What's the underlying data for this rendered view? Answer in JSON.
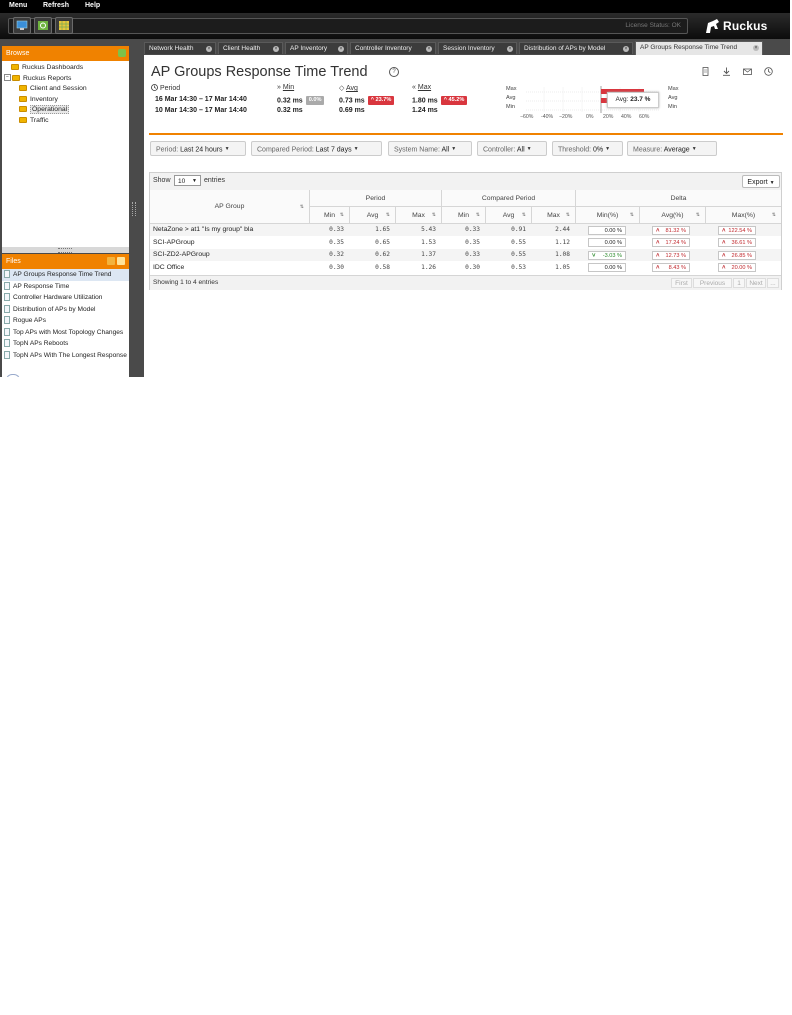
{
  "menu": [
    "Menu",
    "Refresh",
    "Help"
  ],
  "toolbar": {
    "license_status": "License Status: OK",
    "brand": "Ruckus"
  },
  "browse": {
    "title": "Browse",
    "tree": [
      {
        "label": "Ruckus Dashboards",
        "level": 0
      },
      {
        "label": "Ruckus Reports",
        "level": 0,
        "expanded": true
      },
      {
        "label": "Client and Session",
        "level": 1
      },
      {
        "label": "Inventory",
        "level": 1
      },
      {
        "label": "Operational",
        "level": 1,
        "selected": true
      },
      {
        "label": "Traffic",
        "level": 1
      }
    ]
  },
  "files": {
    "title": "Files",
    "items": [
      "AP Groups Response Time Trend",
      "AP Response Time",
      "Controller Hardware Utilization",
      "Distribution of APs by Model",
      "Rogue APs",
      "Top APs with Most Topology Changes",
      "TopN APs Reboots",
      "TopN APs With The Longest Response"
    ]
  },
  "tabs": [
    {
      "label": "Network Health",
      "active": false
    },
    {
      "label": "Client Health",
      "active": false
    },
    {
      "label": "AP Inventory",
      "active": false
    },
    {
      "label": "Controller Inventory",
      "active": false
    },
    {
      "label": "Session Inventory",
      "active": false
    },
    {
      "label": "Distribution of APs by Model",
      "active": false
    },
    {
      "label": "AP Groups Response Time Trend",
      "active": true
    }
  ],
  "report": {
    "title": "AP Groups Response Time Trend",
    "period_label": "Period",
    "min_label": "Min",
    "avg_label": "Avg",
    "max_label": "Max",
    "period": "16 Mar 14:30 – 17 Mar 14:40",
    "compared_period": "10 Mar 14:30 – 17 Mar 14:40",
    "period_min": "0.32 ms",
    "period_min_delta": "0.0%",
    "period_avg": "0.73 ms",
    "period_avg_delta": "23.7%",
    "period_max": "1.80 ms",
    "period_max_delta": "45.2%",
    "compared_min": "0.32 ms",
    "compared_avg": "0.69 ms",
    "compared_max": "1.24 ms"
  },
  "mini_chart": {
    "left_labels": [
      "Max",
      "Avg",
      "Min"
    ],
    "right_labels": [
      "Max",
      "Avg",
      "Min"
    ],
    "ticks": [
      "−60%",
      "-40%",
      "−20%",
      "0%",
      "20%",
      "40%",
      "60%"
    ],
    "tooltip_label": "Avg:",
    "tooltip_value": "23.7 %",
    "bar_color": "#d9363e"
  },
  "filters": {
    "period": {
      "label": "Period:",
      "value": "Last 24 hours"
    },
    "compared": {
      "label": "Compared Period:",
      "value": "Last 7 days"
    },
    "system": {
      "label": "System Name:",
      "value": "All"
    },
    "controller": {
      "label": "Controller:",
      "value": "All"
    },
    "threshold": {
      "label": "Threshold:",
      "value": "0%"
    },
    "measure": {
      "label": "Measure:",
      "value": "Average"
    }
  },
  "table": {
    "show_label": "Show",
    "entries_label": "entries",
    "page_size": "10",
    "export_label": "Export",
    "group_headers": {
      "ap_group": "AP Group",
      "period": "Period",
      "compared": "Compared Period",
      "delta": "Delta"
    },
    "sub_headers": [
      "Min",
      "Avg",
      "Max",
      "Min",
      "Avg",
      "Max",
      "Min(%)",
      "Avg(%)",
      "Max(%)"
    ],
    "rows": [
      {
        "name": "NetaZone > at1 \"Is my group\" bla",
        "p_min": "0.33",
        "p_avg": "1.65",
        "p_max": "5.43",
        "c_min": "0.33",
        "c_avg": "0.91",
        "c_max": "2.44",
        "d_min": "0.00 %",
        "d_min_dir": "none",
        "d_avg": "81.32 %",
        "d_avg_dir": "up",
        "d_max": "122.54 %",
        "d_max_dir": "up"
      },
      {
        "name": "SCI-APGroup",
        "p_min": "0.35",
        "p_avg": "0.65",
        "p_max": "1.53",
        "c_min": "0.35",
        "c_avg": "0.55",
        "c_max": "1.12",
        "d_min": "0.00 %",
        "d_min_dir": "none",
        "d_avg": "17.24 %",
        "d_avg_dir": "up",
        "d_max": "36.61 %",
        "d_max_dir": "up"
      },
      {
        "name": "SCI-ZD2-APGroup",
        "p_min": "0.32",
        "p_avg": "0.62",
        "p_max": "1.37",
        "c_min": "0.33",
        "c_avg": "0.55",
        "c_max": "1.08",
        "d_min": "-3.03 %",
        "d_min_dir": "down",
        "d_avg": "12.73 %",
        "d_avg_dir": "up",
        "d_max": "26.85 %",
        "d_max_dir": "up"
      },
      {
        "name": "IDC Office",
        "p_min": "0.30",
        "p_avg": "0.58",
        "p_max": "1.26",
        "c_min": "0.30",
        "c_avg": "0.53",
        "c_max": "1.05",
        "d_min": "0.00 %",
        "d_min_dir": "none",
        "d_avg": "8.43 %",
        "d_avg_dir": "up",
        "d_max": "20.00 %",
        "d_max_dir": "up"
      }
    ],
    "info": "Showing 1 to 4 entries",
    "pager": [
      "First",
      "Previous",
      "1",
      "Next",
      "..."
    ]
  },
  "colors": {
    "accent": "#f08200",
    "negative": "#d9363e",
    "positive": "#2a8a2a"
  }
}
